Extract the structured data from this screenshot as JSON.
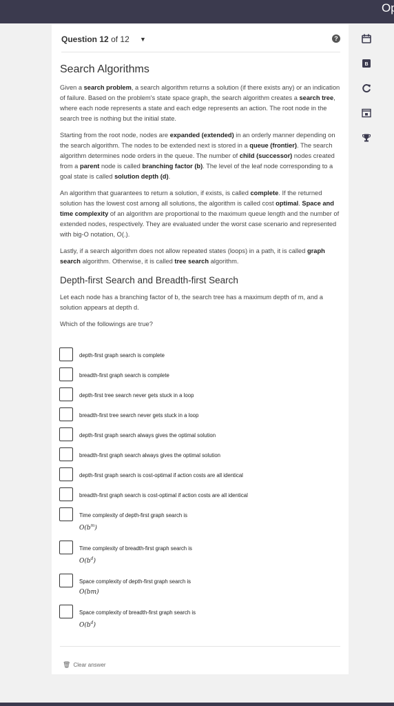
{
  "header": {
    "brand": "Op"
  },
  "question": {
    "label_prefix": "Question",
    "number": "12",
    "of_text": "of 12",
    "caret": "▼",
    "help": "?"
  },
  "content": {
    "title": "Search Algorithms",
    "p1": [
      {
        "t": "Given a "
      },
      {
        "t": "search problem",
        "b": true
      },
      {
        "t": ", a search algorithm returns a solution (if there exists any) or an indication of failure. Based on the problem's state space graph, the search algorithm creates a "
      },
      {
        "t": "search tree",
        "b": true
      },
      {
        "t": ", where each node represents a state and each edge represents an action. The root node in the search tree is nothing but the initial state."
      }
    ],
    "p2": [
      {
        "t": "Starting from the root node, nodes are "
      },
      {
        "t": "expanded (extended)",
        "b": true
      },
      {
        "t": " in an orderly manner depending on the search algorithm. The nodes to be extended next is stored in a "
      },
      {
        "t": "queue (frontier)",
        "b": true
      },
      {
        "t": ". The search algorithm determines node orders in the queue. The number of "
      },
      {
        "t": "child (successor)",
        "b": true
      },
      {
        "t": " nodes created from a "
      },
      {
        "t": "parent",
        "b": true
      },
      {
        "t": " node is called "
      },
      {
        "t": "branching factor (b)",
        "b": true
      },
      {
        "t": ". The level of the leaf node corresponding to a goal state is called "
      },
      {
        "t": "solution depth (d)",
        "b": true
      },
      {
        "t": "."
      }
    ],
    "p3": [
      {
        "t": "An algorithm that guarantees to return a solution, if exists, is called "
      },
      {
        "t": "complete",
        "b": true
      },
      {
        "t": ". If the returned solution has the lowest cost among all solutions, the algorithm is called cost "
      },
      {
        "t": "optimal",
        "b": true
      },
      {
        "t": ". "
      },
      {
        "t": "Space and time complexity",
        "b": true
      },
      {
        "t": " of an algorithm are proportional to the maximum queue length and the number of extended nodes, respectively. They are evaluated under the worst case scenario and represented with big-O notation, O(.)."
      }
    ],
    "p4": [
      {
        "t": "Lastly, if a search algorithm does not allow repeated states (loops) in a path, it is called "
      },
      {
        "t": "graph search",
        "b": true
      },
      {
        "t": " algorithm. Otherwise, it is called "
      },
      {
        "t": "tree search",
        "b": true
      },
      {
        "t": " algorithm."
      }
    ],
    "subtitle": "Depth-first Search and Breadth-first Search",
    "p5": "Let each node has a branching factor of b, the search tree has a maximum depth of m, and a solution appears at depth d.",
    "prompt": "Which of the followings are true?"
  },
  "options": [
    {
      "text": "depth-first graph search is complete"
    },
    {
      "text": "breadth-first graph search is complete"
    },
    {
      "text": "depth-first tree search never gets stuck in a loop"
    },
    {
      "text": "breadth-first tree search never gets stuck in a loop"
    },
    {
      "text": "depth-first graph search always gives the optimal solution"
    },
    {
      "text": "breadth-first graph search always gives the optimal solution"
    },
    {
      "text": "depth-first graph search is cost-optimal if action costs are all identical"
    },
    {
      "text": "breadth-first graph search is cost-optimal if action costs are all identical"
    },
    {
      "text": "Time complexity of depth-first graph search is",
      "math_base": "O(b",
      "math_sup": "m",
      "math_end": ")"
    },
    {
      "text": "Time complexity of breadth-first graph search is",
      "math_base": "O(b",
      "math_sup": "d",
      "math_end": ")"
    },
    {
      "text": "Space complexity of depth-first graph search is",
      "math_base": "O(bm)",
      "math_sup": "",
      "math_end": ""
    },
    {
      "text": "Space complexity of breadth-first graph search is",
      "math_base": "O(b",
      "math_sup": "d",
      "math_end": ")"
    }
  ],
  "footer": {
    "clear_label": "Clear answer"
  },
  "sidebar": {
    "icons": [
      "calendar-icon",
      "bookmark-badge-icon",
      "refresh-icon",
      "lock-window-icon",
      "trophy-icon"
    ],
    "badge_letter": "B"
  },
  "colors": {
    "topbar": "#3b3a4e",
    "accent": "#3b3a4e"
  }
}
